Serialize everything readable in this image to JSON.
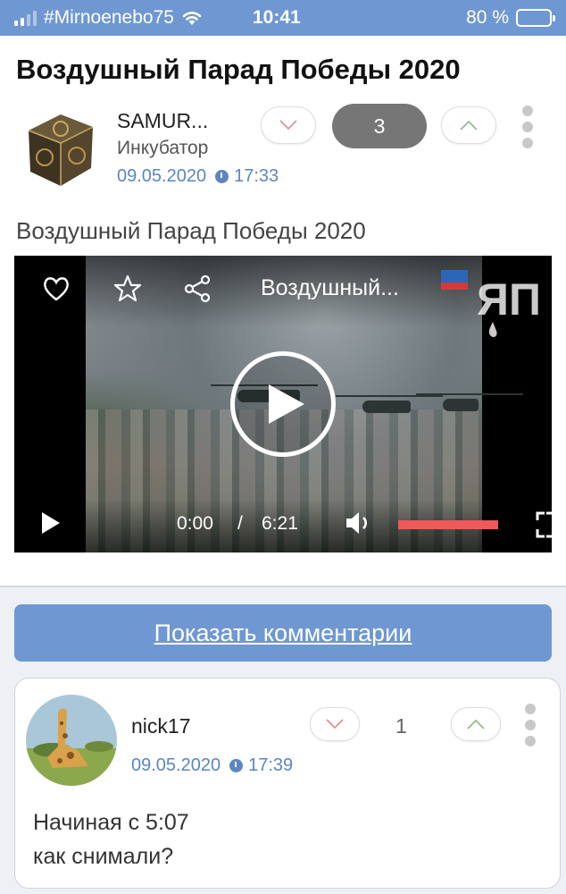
{
  "status_bar": {
    "carrier": "#Mirnoenebo75",
    "time": "10:41",
    "battery": "80 %"
  },
  "post": {
    "title": "Воздушный Парад Победы 2020",
    "author": "SAMUR...",
    "community": "Инкубатор",
    "date": "09.05.2020",
    "time": "17:33",
    "rating": "3",
    "subtitle": "Воздушный Парад Победы 2020",
    "video": {
      "title": "Воздушный...",
      "current_time": "0:00",
      "separator": "/",
      "duration": "6:21",
      "logo_text": "ЯП"
    }
  },
  "show_comments_label": "Показать комментарии",
  "comment": {
    "author": "nick17",
    "date": "09.05.2020",
    "time": "17:39",
    "rating": "1",
    "text": "Начиная с 5:07\nкак снимали?"
  },
  "colors": {
    "accent": "#6f97d2",
    "link": "#5b86c2",
    "badge": "#767676",
    "progress": "#ec5a5a"
  }
}
